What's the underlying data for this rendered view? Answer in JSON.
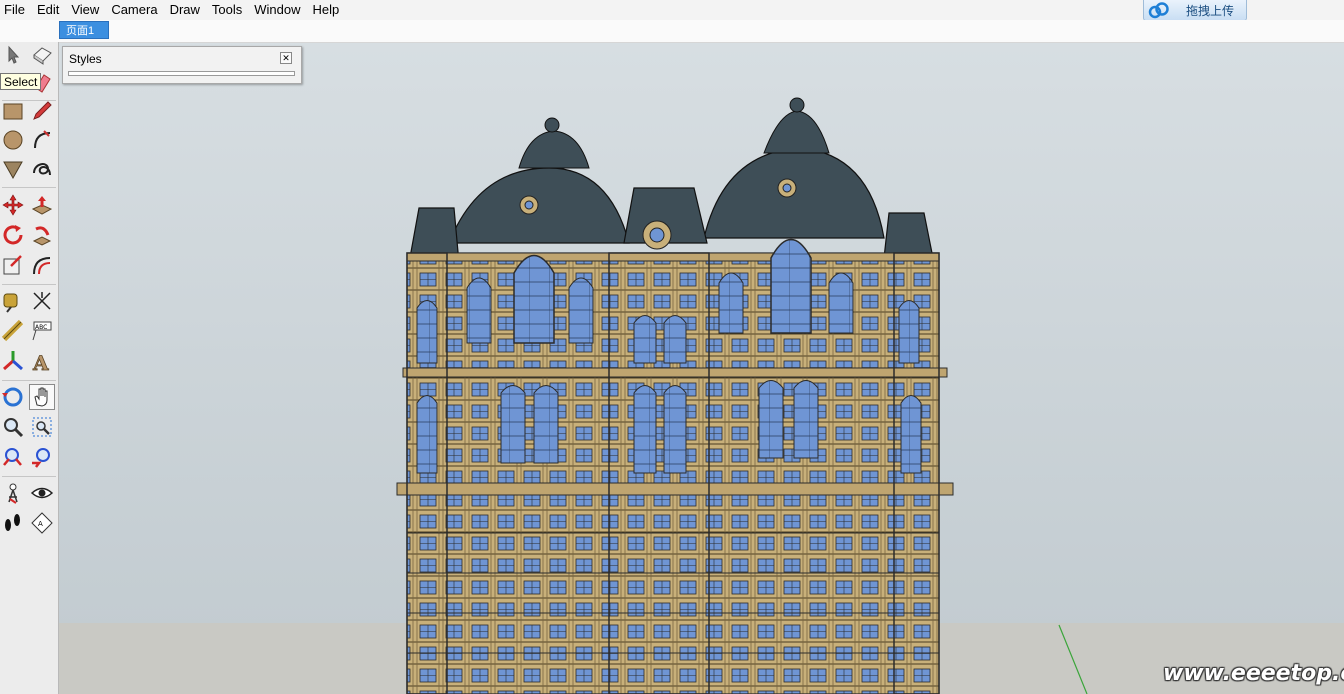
{
  "menu": [
    {
      "label": "File"
    },
    {
      "label": "Edit"
    },
    {
      "label": "View"
    },
    {
      "label": "Camera"
    },
    {
      "label": "Draw"
    },
    {
      "label": "Tools"
    },
    {
      "label": "Window"
    },
    {
      "label": "Help"
    }
  ],
  "upload_button": {
    "label": "拖拽上传",
    "icon": "cloud-icon"
  },
  "scene_tab": {
    "label": "页面1"
  },
  "tooltip": {
    "text": "Select"
  },
  "styles_panel": {
    "title": "Styles",
    "close_icon": "close-icon"
  },
  "watermark": {
    "text": "www.eeeetop.com"
  },
  "toolbar_tools": [
    "select-arrow-icon",
    "make-component-icon",
    "paint-bucket-icon",
    "eraser-icon",
    "rectangle-icon",
    "pencil-icon",
    "circle-icon",
    "arc-icon",
    "polygon-icon",
    "freehand-icon",
    "move-icon",
    "push-pull-icon",
    "rotate-icon",
    "follow-me-icon",
    "scale-icon",
    "offset-icon",
    "tape-measure-icon",
    "dimension-icon",
    "protractor-icon",
    "text-icon",
    "axes-icon",
    "3d-text-icon",
    "orbit-icon",
    "pan-icon",
    "zoom-icon",
    "zoom-window-icon",
    "zoom-extents-icon",
    "previous-view-icon",
    "position-camera-icon",
    "look-around-icon",
    "walk-icon",
    "section-plane-icon"
  ],
  "colors": {
    "viewport_sky": "#d0d8dc",
    "ground": "#c9c9c4",
    "facade": "#c8b07a",
    "roof": "#3e4e57",
    "glass": "#6f95d4",
    "tab": "#3c8fe0",
    "tooltip_bg": "#ffffe1"
  }
}
